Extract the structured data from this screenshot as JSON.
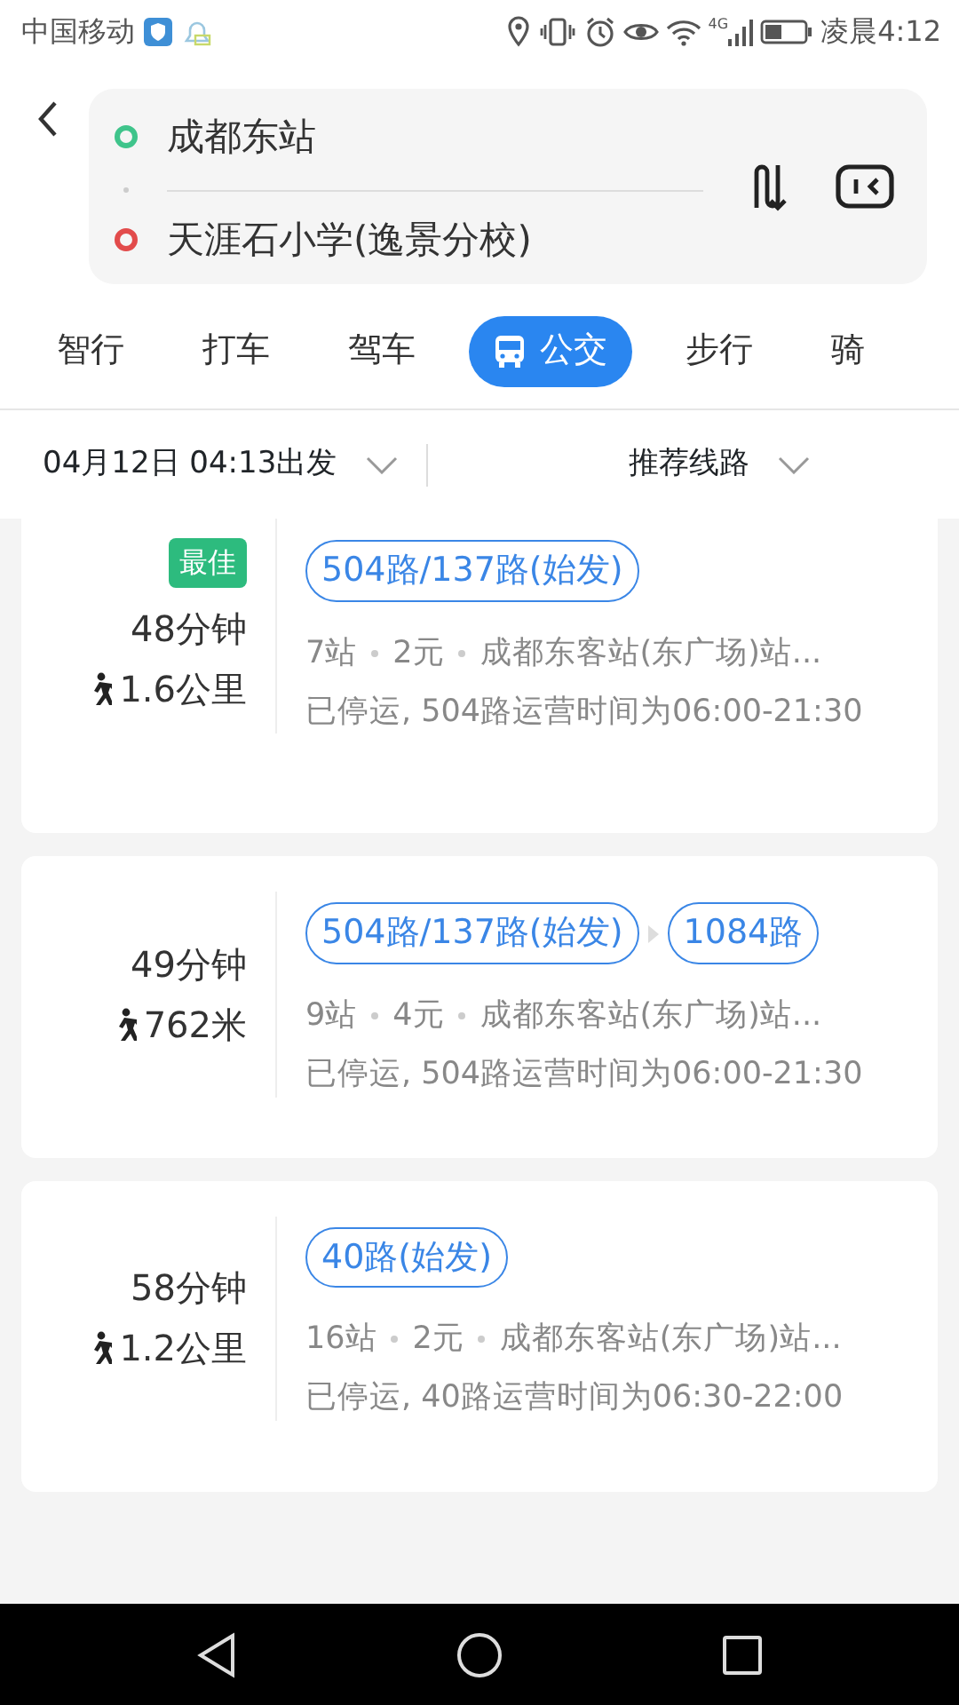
{
  "status_bar": {
    "carrier": "中国移动",
    "network": "4G",
    "time": "凌晨4:12"
  },
  "route_input": {
    "origin": "成都东站",
    "destination": "天涯石小学(逸景分校)"
  },
  "tabs": [
    {
      "label": "智行",
      "selected": false
    },
    {
      "label": "打车",
      "selected": false
    },
    {
      "label": "驾车",
      "selected": false
    },
    {
      "label": "公交",
      "selected": true
    },
    {
      "label": "步行",
      "selected": false
    },
    {
      "label": "骑",
      "selected": false
    }
  ],
  "filters": {
    "departure": "04月12日 04:13出发",
    "sort": "推荐线路"
  },
  "routes": [
    {
      "badge": "最佳",
      "duration": "48分钟",
      "walk": "1.6公里",
      "lines": [
        "504路/137路(始发)"
      ],
      "stops": "7站",
      "fare": "2元",
      "station": "成都东客站(东广场)站...",
      "note": "已停运, 504路运营时间为06:00-21:30"
    },
    {
      "duration": "49分钟",
      "walk": "762米",
      "lines": [
        "504路/137路(始发)",
        "1084路"
      ],
      "stops": "9站",
      "fare": "4元",
      "station": "成都东客站(东广场)站...",
      "note": "已停运, 504路运营时间为06:00-21:30"
    },
    {
      "duration": "58分钟",
      "walk": "1.2公里",
      "lines": [
        "40路(始发)"
      ],
      "stops": "16站",
      "fare": "2元",
      "station": "成都东客站(东广场)站...",
      "note": "已停运, 40路运营时间为06:30-22:00"
    }
  ]
}
